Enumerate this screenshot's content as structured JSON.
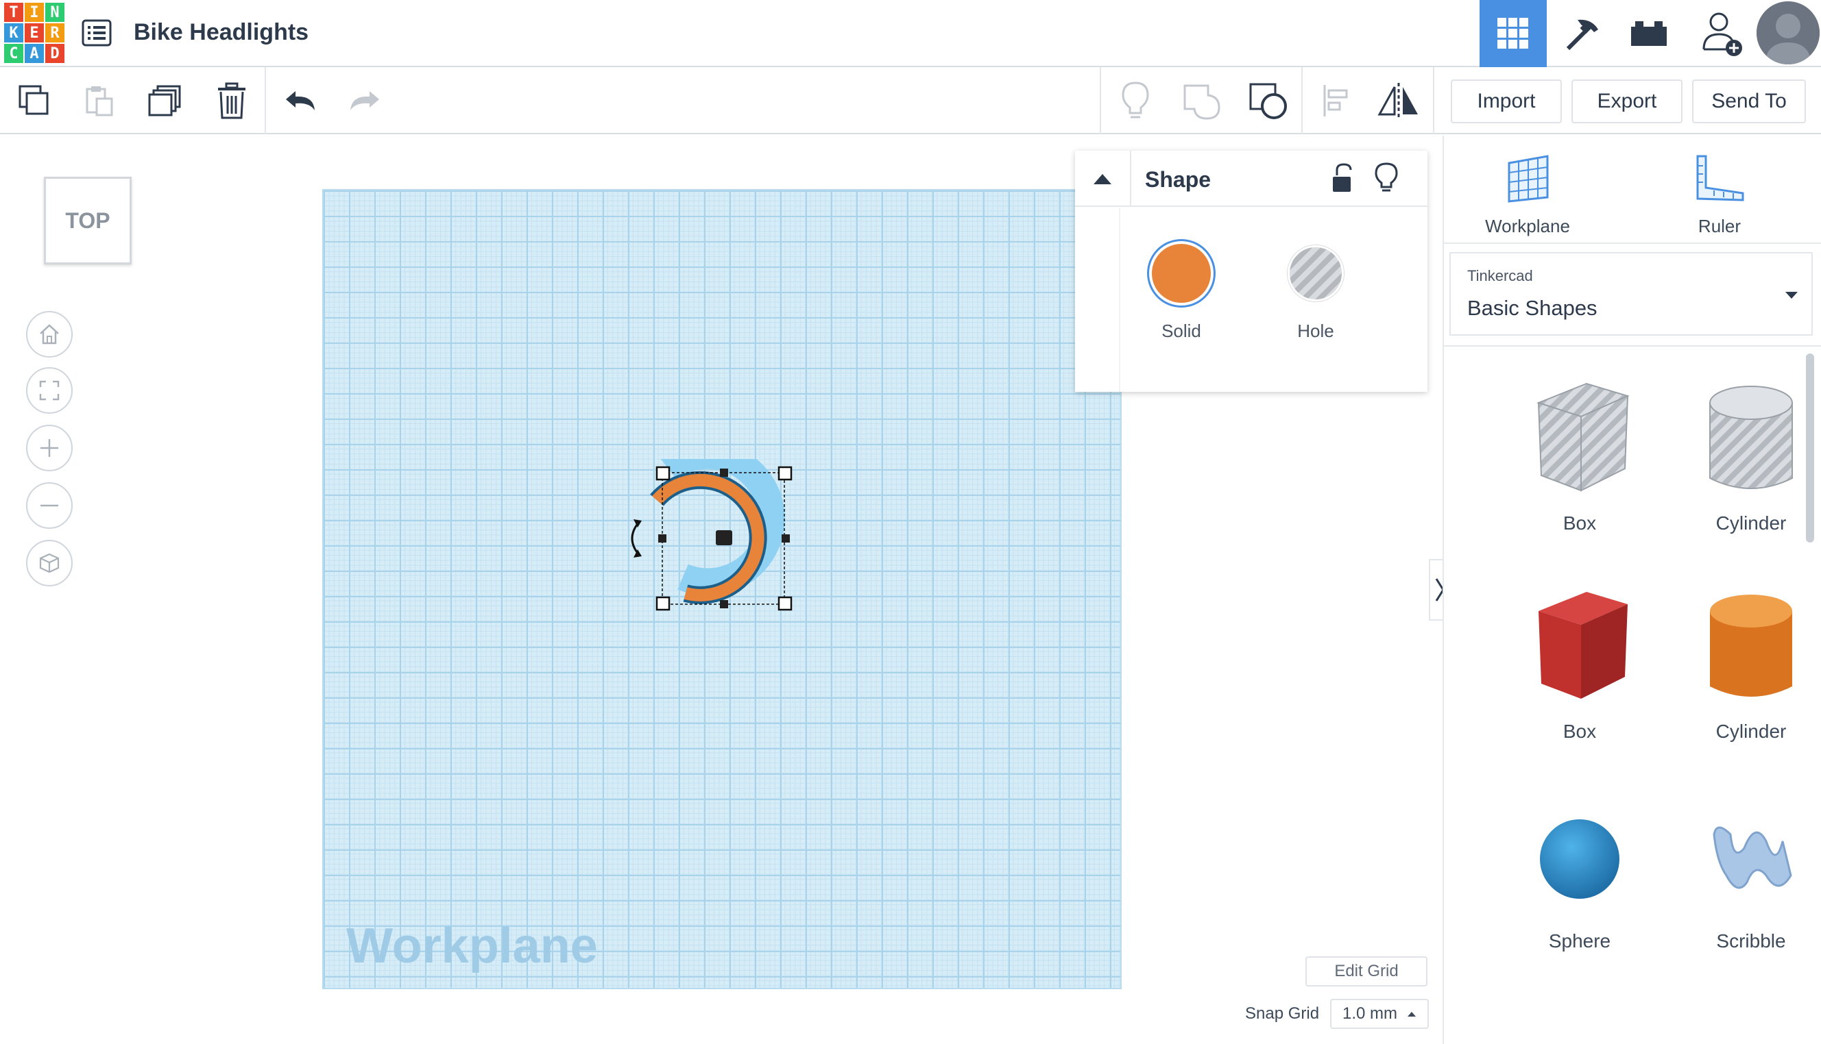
{
  "app": {
    "logo_letters": [
      "T",
      "I",
      "N",
      "K",
      "E",
      "R",
      "C",
      "A",
      "D"
    ],
    "logo_colors": [
      "#e8452c",
      "#f39c12",
      "#2ecc71",
      "#3498db",
      "#e8452c",
      "#f39c12",
      "#2ecc71",
      "#3498db",
      "#e8452c"
    ],
    "document_title": "Bike Headlights"
  },
  "header": {
    "icons": [
      "grid-view-icon",
      "pickaxe-icon",
      "bricks-icon",
      "add-user-icon",
      "avatar"
    ]
  },
  "toolbar": {
    "import_label": "Import",
    "export_label": "Export",
    "send_to_label": "Send To"
  },
  "view": {
    "view_cube_label": "TOP"
  },
  "workplane": {
    "label": "Workplane"
  },
  "shape_panel": {
    "title": "Shape",
    "solid_label": "Solid",
    "hole_label": "Hole",
    "solid_color": "#e8843a"
  },
  "right_panel": {
    "workplane_label": "Workplane",
    "ruler_label": "Ruler",
    "library_source": "Tinkercad",
    "library_name": "Basic Shapes",
    "shapes": [
      {
        "name": "Box"
      },
      {
        "name": "Cylinder"
      },
      {
        "name": "Box"
      },
      {
        "name": "Cylinder"
      },
      {
        "name": "Sphere"
      },
      {
        "name": "Scribble"
      }
    ]
  },
  "grid": {
    "edit_grid_label": "Edit Grid",
    "snap_label": "Snap Grid",
    "snap_value": "1.0 mm"
  }
}
